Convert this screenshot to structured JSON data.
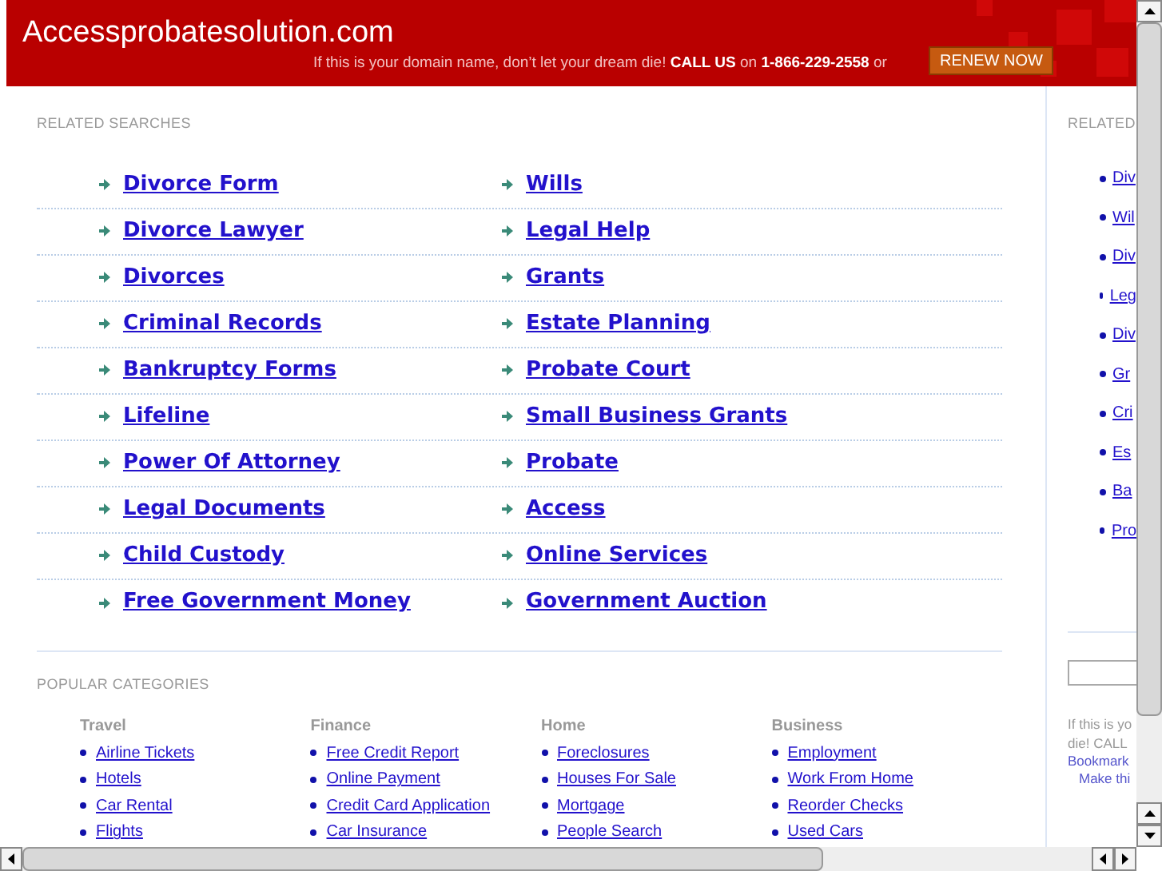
{
  "header": {
    "domain": "Accessprobatesolution.com",
    "notice": "If this is your domain name, don’t let your dream die! **CALL US** on **1-866-229-2558** or",
    "button": "RENEW NOW"
  },
  "related_searches": {
    "title": "RELATED SEARCHES",
    "left": [
      "Divorce Form",
      "Divorce Lawyer",
      "Divorces",
      "Criminal Records",
      "Bankruptcy Forms",
      "Lifeline",
      "Power Of Attorney",
      "Legal Documents",
      "Child Custody",
      "Free Government Money"
    ],
    "right": [
      "Wills",
      "Legal Help",
      "Grants",
      "Estate Planning",
      "Probate Court",
      "Small Business Grants",
      "Probate",
      "Access",
      "Online Services",
      "Government Auction"
    ]
  },
  "popular_categories": {
    "title": "POPULAR CATEGORIES",
    "columns": [
      {
        "heading": "Travel",
        "links": [
          "Airline Tickets",
          "Hotels",
          "Car Rental",
          "Flights"
        ]
      },
      {
        "heading": "Finance",
        "links": [
          "Free Credit Report",
          "Online Payment",
          "Credit Card Application",
          "Car Insurance"
        ]
      },
      {
        "heading": "Home",
        "links": [
          "Foreclosures",
          "Houses For Sale",
          "Mortgage",
          "People Search"
        ]
      },
      {
        "heading": "Business",
        "links": [
          "Employment",
          "Work From Home",
          "Reorder Checks",
          "Used Cars"
        ]
      }
    ]
  },
  "sidebar": {
    "title": "RELATED",
    "links": [
      "Div",
      "Wil",
      "Div",
      "Leg",
      "Div",
      "Gr",
      "Cri",
      "Es",
      "Ba",
      "Pro"
    ],
    "notice_lines": [
      "If this is yo",
      "die! CALL"
    ],
    "bookmark": "Bookmark",
    "make": "Make thi"
  }
}
